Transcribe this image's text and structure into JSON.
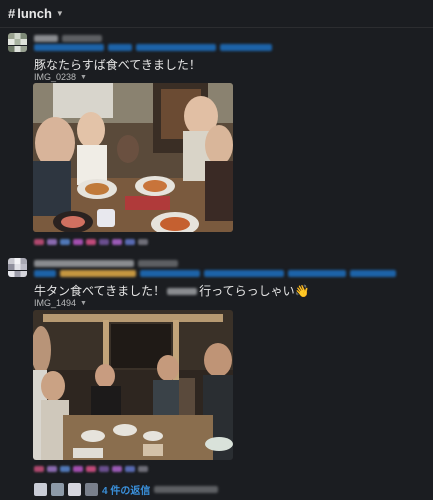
{
  "channel": {
    "hash": "#",
    "name": "lunch"
  },
  "messages": [
    {
      "text": "豚なたらすば食べてきました！",
      "file_name": "IMG_0238"
    },
    {
      "text_before": "牛タン食べてきました！",
      "text_after": "行ってらっしゃい",
      "emoji": "👋",
      "file_name": "IMG_1494",
      "thread": {
        "replies_label": "4 件の返信"
      }
    }
  ],
  "colors": {
    "background": "#1b1d21",
    "link": "#1d63a8",
    "reply_link": "#3a8fd9",
    "text": "#e6e6e6"
  }
}
